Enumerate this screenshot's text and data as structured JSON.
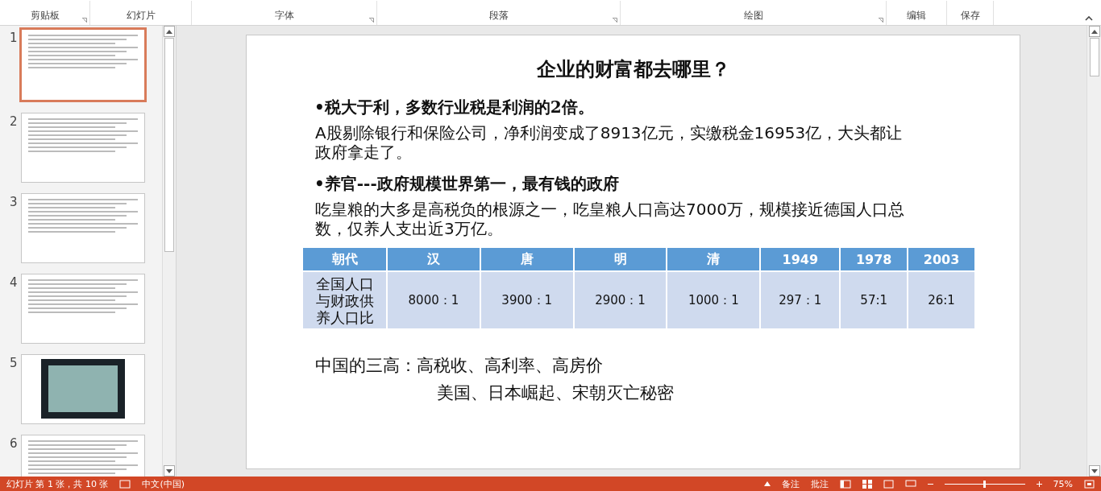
{
  "ribbon": {
    "groups": [
      {
        "label": "剪贴板",
        "launcher": true
      },
      {
        "label": "幻灯片",
        "launcher": false
      },
      {
        "label": "字体",
        "launcher": true
      },
      {
        "label": "段落",
        "launcher": true
      },
      {
        "label": "绘图",
        "launcher": true
      },
      {
        "label": "编辑",
        "launcher": false
      },
      {
        "label": "保存",
        "launcher": false
      }
    ]
  },
  "thumbnails": [
    {
      "number": "1",
      "selected": true,
      "kind": "text"
    },
    {
      "number": "2",
      "selected": false,
      "kind": "text"
    },
    {
      "number": "3",
      "selected": false,
      "kind": "text"
    },
    {
      "number": "4",
      "selected": false,
      "kind": "text"
    },
    {
      "number": "5",
      "selected": false,
      "kind": "photo"
    },
    {
      "number": "6",
      "selected": false,
      "kind": "text"
    }
  ],
  "slide": {
    "title": "企业的财富都去哪里？",
    "blocks": [
      {
        "kind": "bullet",
        "text": "•税大于利，多数行业税是利润的2倍。"
      },
      {
        "kind": "para",
        "text": "A股剔除银行和保险公司，净利润变成了8913亿元，实缴税金16953亿，大头都让政府拿走了。"
      },
      {
        "kind": "bullet",
        "text": "•养官---政府规模世界第一，最有钱的政府"
      },
      {
        "kind": "para",
        "text": "吃皇粮的大多是高税负的根源之一，吃皇粮人口高达7000万，规模接近德国人口总数，仅养人支出近3万亿。"
      }
    ],
    "table": {
      "columns": [
        "朝代",
        "汉",
        "唐",
        "明",
        "清",
        "1949",
        "1978",
        "2003"
      ],
      "rows": [
        [
          "全国人口与财政供养人口比",
          "8000：1",
          "3900：1",
          "2900：1",
          "1000：1",
          "297：1",
          "57:1",
          "26:1"
        ]
      ]
    },
    "footer_lines": [
      "中国的三高：高税收、高利率、高房价",
      "美国、日本崛起、宋朝灭亡秘密"
    ]
  },
  "status_bar": {
    "slide_info": "幻灯片 第 1 张，共 10 张",
    "language": "中文(中国)",
    "notes": "备注",
    "comments": "批注",
    "zoom_slider": {
      "level": 0.5
    },
    "zoom": "75%"
  }
}
